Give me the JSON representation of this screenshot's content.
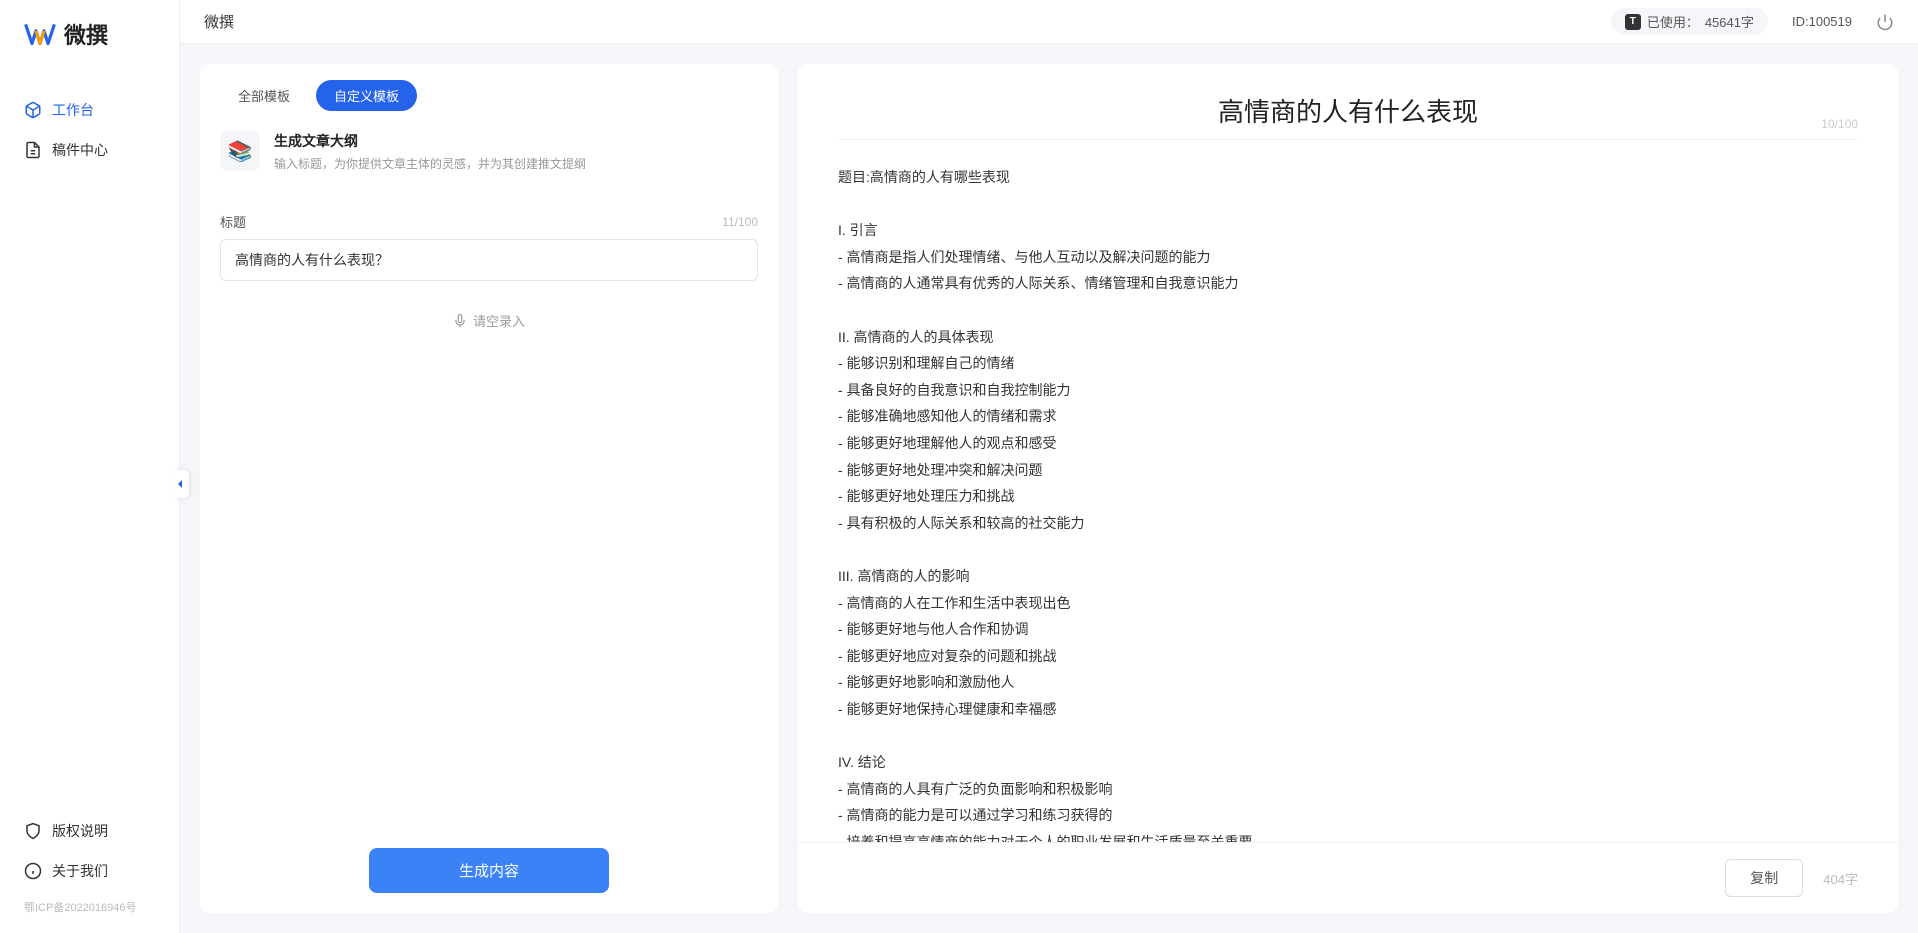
{
  "app_name": "微撰",
  "topbar": {
    "title": "微撰",
    "usage_label": "已使用：",
    "usage_value": "45641字",
    "user_id_label": "ID:",
    "user_id": "100519"
  },
  "sidebar": {
    "nav": [
      {
        "label": "工作台",
        "active": true
      },
      {
        "label": "稿件中心",
        "active": false
      }
    ],
    "bottom": [
      {
        "label": "版权说明"
      },
      {
        "label": "关于我们"
      }
    ],
    "icp": "鄂ICP备2022016946号"
  },
  "left_panel": {
    "tabs": [
      {
        "label": "全部模板",
        "active": false
      },
      {
        "label": "自定义模板",
        "active": true
      }
    ],
    "template": {
      "icon_emoji": "📚",
      "title": "生成文章大纲",
      "desc": "输入标题，为你提供文章主体的灵感，并为其创建推文提纲"
    },
    "form": {
      "title_label": "标题",
      "title_count": "11/100",
      "title_value": "高情商的人有什么表现？",
      "voice_label": "请空录入"
    },
    "generate_btn": "生成内容"
  },
  "right_panel": {
    "title": "高情商的人有什么表现",
    "title_count": "10/100",
    "body": "题目:高情商的人有哪些表现\n\nI. 引言\n- 高情商是指人们处理情绪、与他人互动以及解决问题的能力\n- 高情商的人通常具有优秀的人际关系、情绪管理和自我意识能力\n\nII. 高情商的人的具体表现\n- 能够识别和理解自己的情绪\n- 具备良好的自我意识和自我控制能力\n- 能够准确地感知他人的情绪和需求\n- 能够更好地理解他人的观点和感受\n- 能够更好地处理冲突和解决问题\n- 能够更好地处理压力和挑战\n- 具有积极的人际关系和较高的社交能力\n\nIII. 高情商的人的影响\n- 高情商的人在工作和生活中表现出色\n- 能够更好地与他人合作和协调\n- 能够更好地应对复杂的问题和挑战\n- 能够更好地影响和激励他人\n- 能够更好地保持心理健康和幸福感\n\nIV. 结论\n- 高情商的人具有广泛的负面影响和积极影响\n- 高情商的能力是可以通过学习和练习获得的\n- 培养和提高高情商的能力对于个人的职业发展和生活质量至关重要。",
    "copy_btn": "复制",
    "word_count": "404字"
  }
}
